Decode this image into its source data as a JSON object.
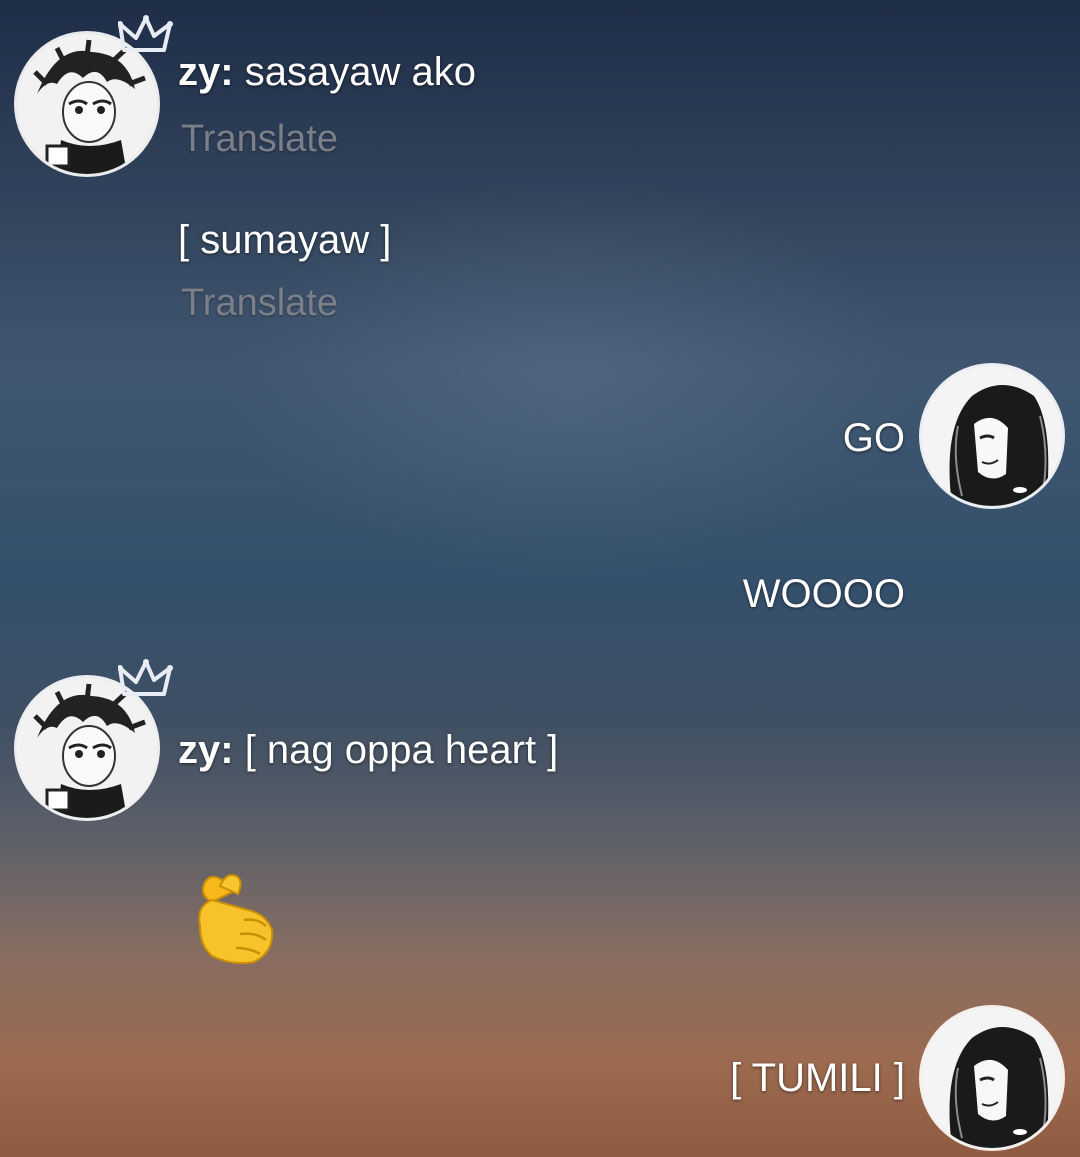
{
  "messages": [
    {
      "sender": "zy:",
      "text": "sasayaw ako",
      "translate": "Translate"
    },
    {
      "text": "[ sumayaw ]",
      "translate": "Translate"
    },
    {
      "text": "GO"
    },
    {
      "text": "WOOOO"
    },
    {
      "sender": "zy:",
      "text": "[ nag oppa heart ]"
    },
    {
      "emoji": "finger-heart-emoji"
    },
    {
      "text": "[ TUMILI ]"
    }
  ],
  "icons": {
    "left_avatar": "anime-boy-avatar",
    "crown": "crown-icon",
    "right_avatar": "long-hair-anime-avatar"
  },
  "colors": {
    "text": "#ffffff",
    "translate": "#7a7f88",
    "crown": "#e8edf5"
  }
}
